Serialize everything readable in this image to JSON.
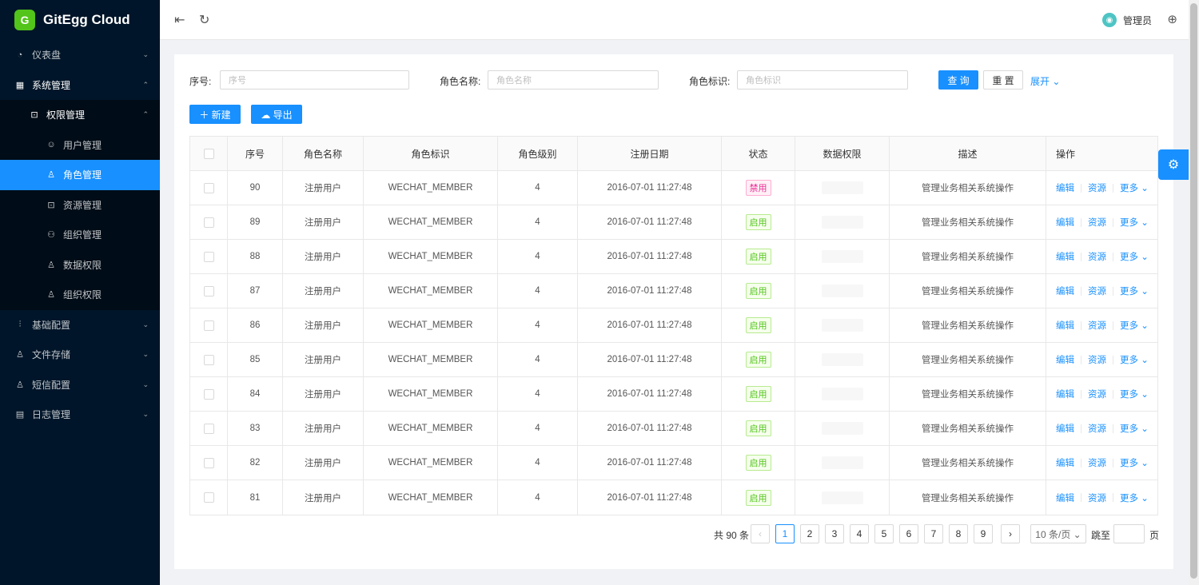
{
  "app": {
    "title": "GitEgg Cloud",
    "logo_glyph": "G"
  },
  "sidebar": {
    "items": [
      {
        "label": "仪表盘",
        "icon": "dashboard-icon",
        "glyph": "◔",
        "level": 1,
        "arrow": "⌄"
      },
      {
        "label": "系统管理",
        "icon": "system-icon",
        "glyph": "▦",
        "level": 1,
        "arrow": "⌃",
        "open": true
      },
      {
        "label": "权限管理",
        "icon": "lock-icon",
        "glyph": "⊡",
        "level": 2,
        "arrow": "⌃",
        "open": true
      },
      {
        "label": "用户管理",
        "icon": "user-icon",
        "glyph": "☺",
        "level": 3
      },
      {
        "label": "角色管理",
        "icon": "role-icon",
        "glyph": "♙",
        "level": 3,
        "active": true
      },
      {
        "label": "资源管理",
        "icon": "lock-icon",
        "glyph": "⊡",
        "level": 3
      },
      {
        "label": "组织管理",
        "icon": "org-icon",
        "glyph": "⚇",
        "level": 3
      },
      {
        "label": "数据权限",
        "icon": "role-icon",
        "glyph": "♙",
        "level": 3
      },
      {
        "label": "组织权限",
        "icon": "role-icon",
        "glyph": "♙",
        "level": 3
      },
      {
        "label": "基础配置",
        "icon": "sliders-icon",
        "glyph": "⫶",
        "level": 1,
        "arrow": "⌄"
      },
      {
        "label": "文件存储",
        "icon": "role-icon",
        "glyph": "♙",
        "level": 1,
        "arrow": "⌄"
      },
      {
        "label": "短信配置",
        "icon": "role-icon",
        "glyph": "♙",
        "level": 1,
        "arrow": "⌄"
      },
      {
        "label": "日志管理",
        "icon": "log-icon",
        "glyph": "▤",
        "level": 1,
        "arrow": "⌄"
      }
    ]
  },
  "header": {
    "menu_fold_glyph": "⇤",
    "reload_glyph": "↻",
    "user_name": "管理员",
    "language_glyph": "⊕"
  },
  "search": {
    "id_label": "序号:",
    "id_placeholder": "序号",
    "name_label": "角色名称:",
    "name_placeholder": "角色名称",
    "key_label": "角色标识:",
    "key_placeholder": "角色标识",
    "query_label": "查 询",
    "reset_label": "重 置",
    "expand_label": "展开 ⌄"
  },
  "toolbar": {
    "new_label": "＋ 新建",
    "export_label": "☁ 导出"
  },
  "table": {
    "columns": [
      "序号",
      "角色名称",
      "角色标识",
      "角色级别",
      "注册日期",
      "状态",
      "数据权限",
      "描述",
      "操作"
    ],
    "rows": [
      {
        "id": "90",
        "name": "注册用户",
        "key": "WECHAT_MEMBER",
        "level": "4",
        "date": "2016-07-01 11:27:48",
        "status": "禁用",
        "enabled": false,
        "desc": "管理业务相关系统操作"
      },
      {
        "id": "89",
        "name": "注册用户",
        "key": "WECHAT_MEMBER",
        "level": "4",
        "date": "2016-07-01 11:27:48",
        "status": "启用",
        "enabled": true,
        "desc": "管理业务相关系统操作"
      },
      {
        "id": "88",
        "name": "注册用户",
        "key": "WECHAT_MEMBER",
        "level": "4",
        "date": "2016-07-01 11:27:48",
        "status": "启用",
        "enabled": true,
        "desc": "管理业务相关系统操作"
      },
      {
        "id": "87",
        "name": "注册用户",
        "key": "WECHAT_MEMBER",
        "level": "4",
        "date": "2016-07-01 11:27:48",
        "status": "启用",
        "enabled": true,
        "desc": "管理业务相关系统操作"
      },
      {
        "id": "86",
        "name": "注册用户",
        "key": "WECHAT_MEMBER",
        "level": "4",
        "date": "2016-07-01 11:27:48",
        "status": "启用",
        "enabled": true,
        "desc": "管理业务相关系统操作"
      },
      {
        "id": "85",
        "name": "注册用户",
        "key": "WECHAT_MEMBER",
        "level": "4",
        "date": "2016-07-01 11:27:48",
        "status": "启用",
        "enabled": true,
        "desc": "管理业务相关系统操作"
      },
      {
        "id": "84",
        "name": "注册用户",
        "key": "WECHAT_MEMBER",
        "level": "4",
        "date": "2016-07-01 11:27:48",
        "status": "启用",
        "enabled": true,
        "desc": "管理业务相关系统操作"
      },
      {
        "id": "83",
        "name": "注册用户",
        "key": "WECHAT_MEMBER",
        "level": "4",
        "date": "2016-07-01 11:27:48",
        "status": "启用",
        "enabled": true,
        "desc": "管理业务相关系统操作"
      },
      {
        "id": "82",
        "name": "注册用户",
        "key": "WECHAT_MEMBER",
        "level": "4",
        "date": "2016-07-01 11:27:48",
        "status": "启用",
        "enabled": true,
        "desc": "管理业务相关系统操作"
      },
      {
        "id": "81",
        "name": "注册用户",
        "key": "WECHAT_MEMBER",
        "level": "4",
        "date": "2016-07-01 11:27:48",
        "status": "启用",
        "enabled": true,
        "desc": "管理业务相关系统操作"
      }
    ],
    "actions": {
      "edit": "编辑",
      "resource": "资源",
      "more": "更多 ⌄"
    }
  },
  "pagination": {
    "total_text": "共 90 条",
    "prev": "‹",
    "next": "›",
    "pages": [
      "1",
      "2",
      "3",
      "4",
      "5",
      "6",
      "7",
      "8",
      "9"
    ],
    "current": "1",
    "page_size": "10 条/页 ⌄",
    "jump_label": "跳至",
    "page_unit": "页"
  },
  "settings": {
    "glyph": "⚙"
  },
  "colors": {
    "primary": "#1890ff",
    "sidebar_bg": "#001529",
    "success": "#52c41a",
    "danger": "#eb2f96"
  }
}
